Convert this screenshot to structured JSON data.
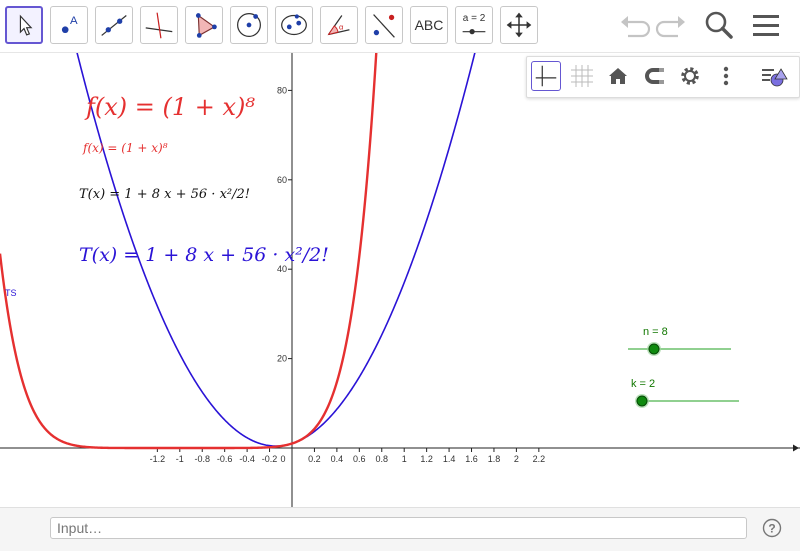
{
  "toolbar": {
    "tools": [
      {
        "id": "move",
        "icon": "cursor-arrow-icon",
        "selected": true
      },
      {
        "id": "point",
        "icon": "point-icon"
      },
      {
        "id": "line",
        "icon": "line-icon"
      },
      {
        "id": "perpendicular",
        "icon": "perpendicular-line-icon"
      },
      {
        "id": "polygon",
        "icon": "polygon-icon"
      },
      {
        "id": "circle",
        "icon": "circle-center-icon"
      },
      {
        "id": "conic",
        "icon": "ellipse-icon"
      },
      {
        "id": "angle",
        "icon": "angle-icon"
      },
      {
        "id": "reflect",
        "icon": "reflect-icon"
      },
      {
        "id": "text",
        "icon": "text-icon",
        "label": "ABC"
      },
      {
        "id": "slider",
        "icon": "slider-icon",
        "label": "a = 2"
      },
      {
        "id": "move-view",
        "icon": "move-graphics-view-icon"
      }
    ],
    "undo_icon": "undo-icon",
    "redo_icon": "redo-icon",
    "search_icon": "search-icon",
    "menu_icon": "hamburger-menu-icon"
  },
  "stylebar": {
    "buttons": [
      "axes-icon",
      "grid-icon",
      "home-icon",
      "magnet-icon",
      "gear-icon",
      "more-vertical-icon",
      "style-bar-toggle-icon"
    ]
  },
  "algebra_text": {
    "f_large": "f(x) = (1 + x)⁸",
    "f_small": "f(x) = (1 + x)⁸",
    "t_small": "T(x) = 1 + 8 x + 56 · x²/2!",
    "t_large": "T(x) = 1 + 8 x + 56 · x²/2!",
    "ts_label": "TS"
  },
  "sliders": [
    {
      "name": "n",
      "label": "n = 8",
      "value": 8
    },
    {
      "name": "k",
      "label": "k = 2",
      "value": 2
    }
  ],
  "input_bar": {
    "placeholder": "Input…",
    "help_icon": "help-icon"
  },
  "colors": {
    "f_curve": "#e53030",
    "taylor_curve": "#2a13d6",
    "slider_point": "#0f8a0f",
    "slider_line": "#90d090",
    "accent": "#6557d2"
  },
  "chart_data": {
    "type": "line",
    "x_ticks": [
      "-1.2",
      "-1",
      "-0.8",
      "-0.6",
      "-0.4",
      "-0.2",
      "0",
      "0.2",
      "0.4",
      "0.6",
      "0.8",
      "1",
      "1.2",
      "1.4",
      "1.6",
      "1.8",
      "2",
      "2.2"
    ],
    "y_ticks": [
      "20",
      "40",
      "60",
      "80"
    ],
    "xlim": [
      -1.3,
      2.3
    ],
    "ylim": [
      -12.5,
      90
    ],
    "series": [
      {
        "name": "f",
        "expression": "(1+x)^8",
        "color": "#e53030"
      },
      {
        "name": "T",
        "expression": "1 + 8x + 28x^2",
        "color": "#2a13d6"
      }
    ]
  }
}
